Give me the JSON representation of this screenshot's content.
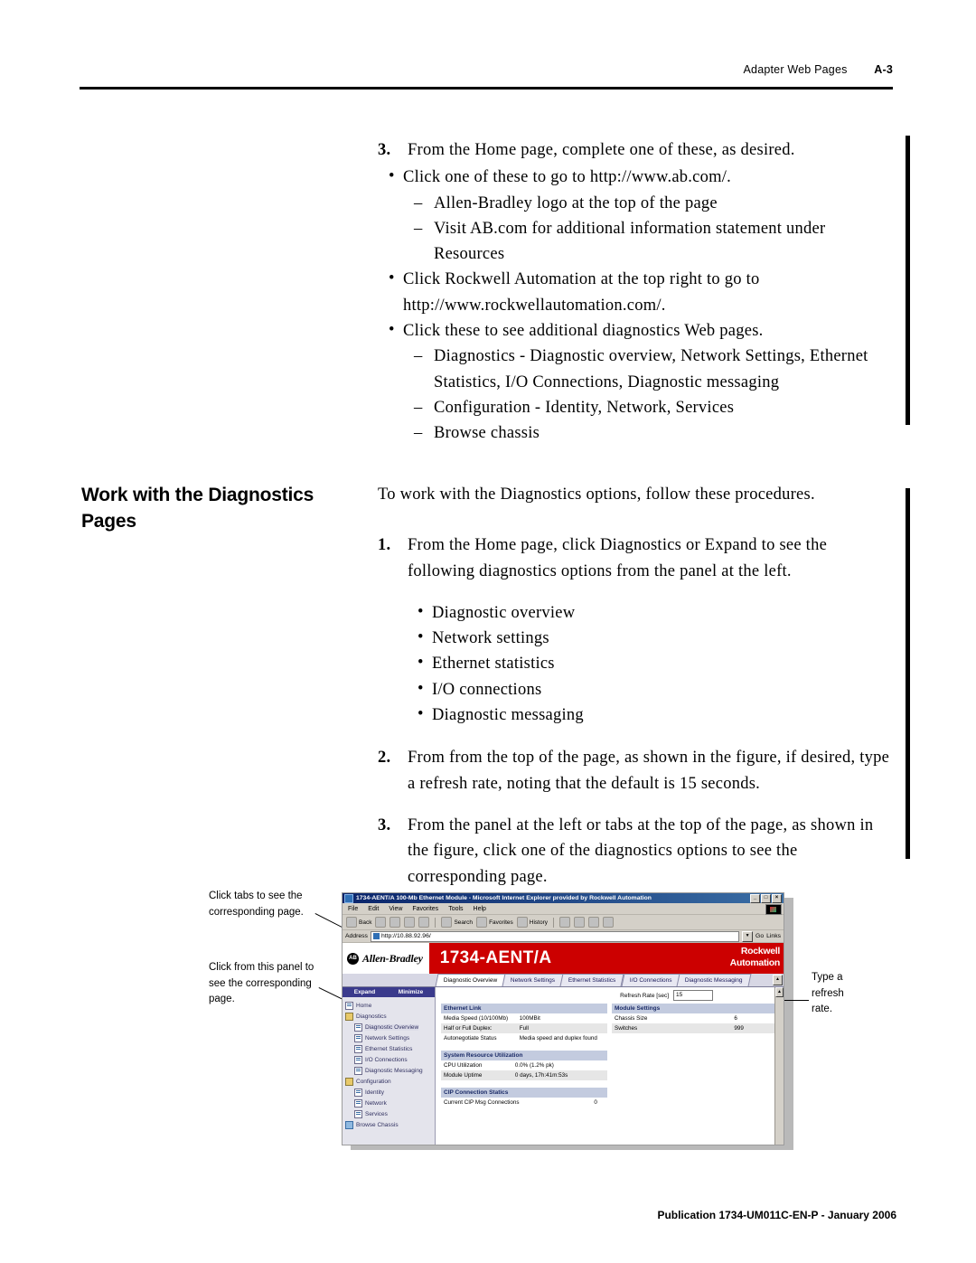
{
  "header": {
    "title": "Adapter Web Pages",
    "page_number": "A-3"
  },
  "footer": {
    "publication": "Publication 1734-UM011C-EN-P - January 2006"
  },
  "section": {
    "heading_line1": "Work with the Diagnostics",
    "heading_line2": "Pages"
  },
  "intro": {
    "text": "To work with the Diagnostics options, follow these procedures."
  },
  "step3_top": {
    "number": "3.",
    "text": "From the Home page, complete one of these, as desired.",
    "bullets": [
      {
        "bullet": "•",
        "text": "Click one of these to go to http://www.ab.com/.",
        "dashes": [
          {
            "dash": "–",
            "text": "Allen-Bradley logo at the top of the page"
          },
          {
            "dash": "–",
            "text": "Visit AB.com for additional information statement under Resources"
          }
        ]
      },
      {
        "bullet": "•",
        "text": "Click Rockwell Automation at the top right to go to http://www.rockwellautomation.com/.",
        "dashes": []
      },
      {
        "bullet": "•",
        "text": "Click these to see additional diagnostics Web pages.",
        "dashes": [
          {
            "dash": "–",
            "text": "Diagnostics - Diagnostic overview, Network Settings, Ethernet Statistics, I/O Connections, Diagnostic messaging"
          },
          {
            "dash": "–",
            "text": "Configuration - Identity, Network, Services"
          },
          {
            "dash": "–",
            "text": "Browse chassis"
          }
        ]
      }
    ]
  },
  "procedure": {
    "step1": {
      "number": "1.",
      "text": "From the Home page, click Diagnostics or Expand to see the following diagnostics options from the panel at the left.",
      "options": [
        {
          "bullet": "•",
          "text": "Diagnostic overview"
        },
        {
          "bullet": "•",
          "text": "Network settings"
        },
        {
          "bullet": "•",
          "text": "Ethernet statistics"
        },
        {
          "bullet": "•",
          "text": "I/O connections"
        },
        {
          "bullet": "•",
          "text": "Diagnostic messaging"
        }
      ]
    },
    "step2": {
      "number": "2.",
      "text": "From from the top of the page, as shown in the figure, if desired, type a refresh rate, noting that the default is 15 seconds."
    },
    "step3": {
      "number": "3.",
      "text": "From the panel at the left or tabs at the top of the page, as shown in the figure, click one of the diagnostics options to see the corresponding page."
    }
  },
  "callouts": {
    "tabs": "Click tabs to see the corresponding page.",
    "panel": "Click from this panel to see the corresponding page.",
    "refresh": "Type a refresh rate."
  },
  "figure": {
    "window": {
      "title": "1734-AENT/A 100-Mb Ethernet Module - Microsoft Internet Explorer provided by Rockwell Automation",
      "icon": "ie-document-icon",
      "buttons": [
        {
          "name": "minimize-button",
          "glyph": "_"
        },
        {
          "name": "maximize-button",
          "glyph": "□"
        },
        {
          "name": "close-button",
          "glyph": "×"
        }
      ]
    },
    "menus": [
      "File",
      "Edit",
      "View",
      "Favorites",
      "Tools",
      "Help"
    ],
    "toolbar": {
      "back": "Back",
      "forward_icon": "forward-arrow-icon",
      "stop_icon": "stop-icon",
      "refresh_icon": "refresh-icon",
      "home_icon": "home-icon",
      "search": "Search",
      "favorites": "Favorites",
      "history": "History",
      "mail_icon": "mail-icon",
      "print_icon": "print-icon",
      "edit_icon": "edit-icon",
      "discuss_icon": "discuss-icon"
    },
    "address": {
      "label": "Address",
      "url": "http://10.88.92.96/",
      "go": "Go",
      "links": "Links"
    },
    "banner": {
      "ab_mark": "AB",
      "ab_name": "Allen-Bradley",
      "model": "1734-AENT/A",
      "ra_line1": "Rockwell",
      "ra_line2": "Automation"
    },
    "tabs": [
      {
        "label": "Diagnostic Overview",
        "active": true
      },
      {
        "label": "Network Settings",
        "active": false
      },
      {
        "label": "Ethernet Statistics",
        "active": false
      },
      {
        "label": "I/O Connections",
        "active": false
      },
      {
        "label": "Diagnostic Messaging",
        "active": false
      }
    ],
    "nav": {
      "expand": "Expand",
      "minimize": "Minimize",
      "items": [
        {
          "label": "Home",
          "icon": "page-icon",
          "indent": 1,
          "selected": false
        },
        {
          "label": "Diagnostics",
          "icon": "folder-icon",
          "indent": 1,
          "selected": false
        },
        {
          "label": "Diagnostic Overview",
          "icon": "page-icon",
          "indent": 2,
          "selected": true
        },
        {
          "label": "Network Settings",
          "icon": "page-icon",
          "indent": 2,
          "selected": false
        },
        {
          "label": "Ethernet Statistics",
          "icon": "page-icon",
          "indent": 2,
          "selected": false
        },
        {
          "label": "I/O Connections",
          "icon": "page-icon",
          "indent": 2,
          "selected": false
        },
        {
          "label": "Diagnostic Messaging",
          "icon": "page-icon",
          "indent": 2,
          "selected": false
        },
        {
          "label": "Configuration",
          "icon": "folder-icon",
          "indent": 1,
          "selected": false
        },
        {
          "label": "Identity",
          "icon": "page-icon",
          "indent": 2,
          "selected": false
        },
        {
          "label": "Network",
          "icon": "page-icon",
          "indent": 2,
          "selected": false
        },
        {
          "label": "Services",
          "icon": "page-icon",
          "indent": 2,
          "selected": false
        },
        {
          "label": "Browse Chassis",
          "icon": "chassis-icon",
          "indent": 1,
          "selected": false
        }
      ]
    },
    "refresh": {
      "label": "Refresh Rate [sec]",
      "value": "15"
    },
    "tables": {
      "ethernet_link": {
        "title": "Ethernet Link",
        "rows": [
          {
            "label": "Media Speed (10/100Mb)",
            "value": "100MBit"
          },
          {
            "label": "Half or Full Duplex:",
            "value": "Full"
          },
          {
            "label": "Autonegotiate Status",
            "value": "Media speed and duplex found"
          }
        ]
      },
      "module_settings": {
        "title": "Module Settings",
        "rows": [
          {
            "label": "Chassis Size",
            "value": "6"
          },
          {
            "label": "Switches",
            "value": "999"
          }
        ]
      },
      "system_resource": {
        "title": "System Resource Utilization",
        "rows": [
          {
            "label": "CPU Utilization",
            "value": "0.0%  (1.2% pk)"
          },
          {
            "label": "Module Uptime",
            "value": "0 days, 17h:41m:53s"
          }
        ]
      },
      "cip_connection": {
        "title": "CIP Connection Statics",
        "rows": [
          {
            "label": "Current CIP Msg Connections",
            "value": "0"
          }
        ]
      }
    }
  }
}
